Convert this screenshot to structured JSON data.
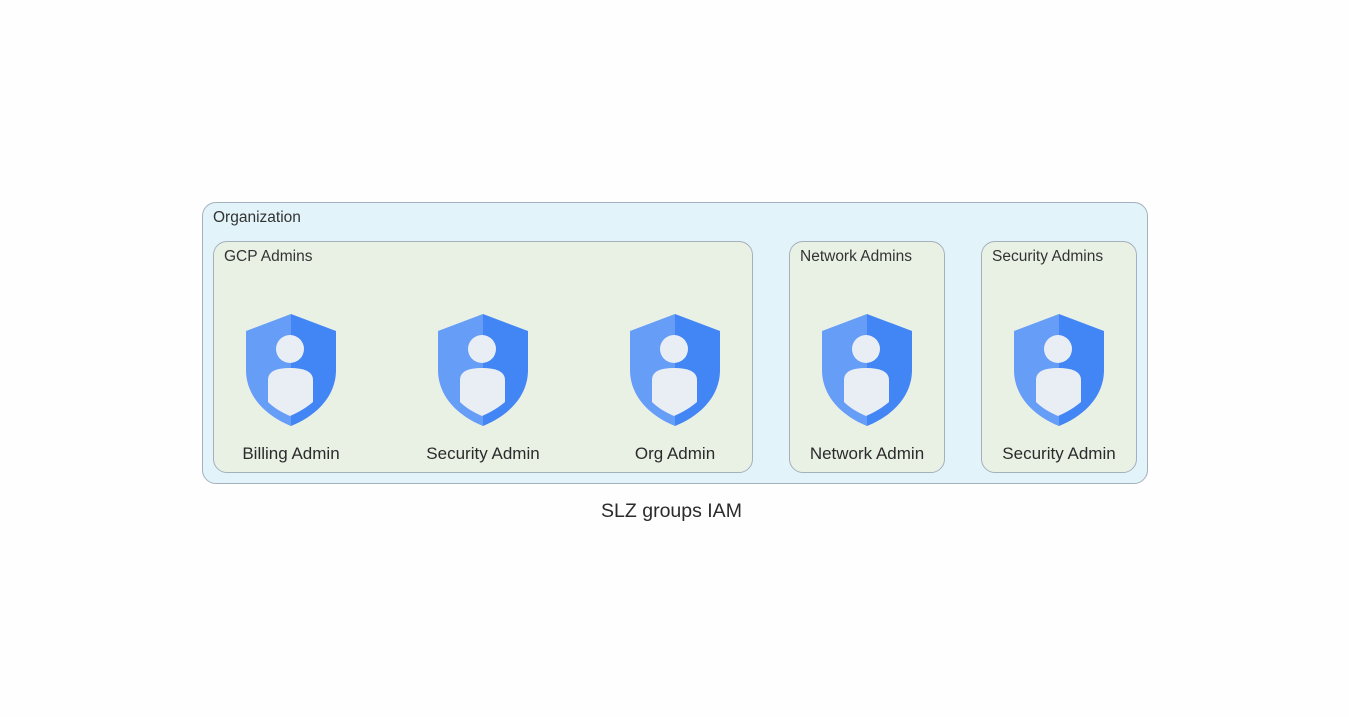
{
  "diagram": {
    "caption": "SLZ groups IAM",
    "organization": {
      "label": "Organization"
    },
    "groups": [
      {
        "label": "GCP Admins",
        "members": [
          "Billing Admin",
          "Security Admin",
          "Org Admin"
        ]
      },
      {
        "label": "Network Admins",
        "members": [
          "Network Admin"
        ]
      },
      {
        "label": "Security Admins",
        "members": [
          "Security Admin"
        ]
      }
    ],
    "node_icon": "admin-shield-user-icon",
    "colors": {
      "organization_fill": "#e2f3fa",
      "group_fill": "#e9f1e5",
      "border": "#a4b0bc",
      "shield_light": "#669df6",
      "shield_dark": "#4285f4",
      "person": "#e8eef4"
    }
  }
}
